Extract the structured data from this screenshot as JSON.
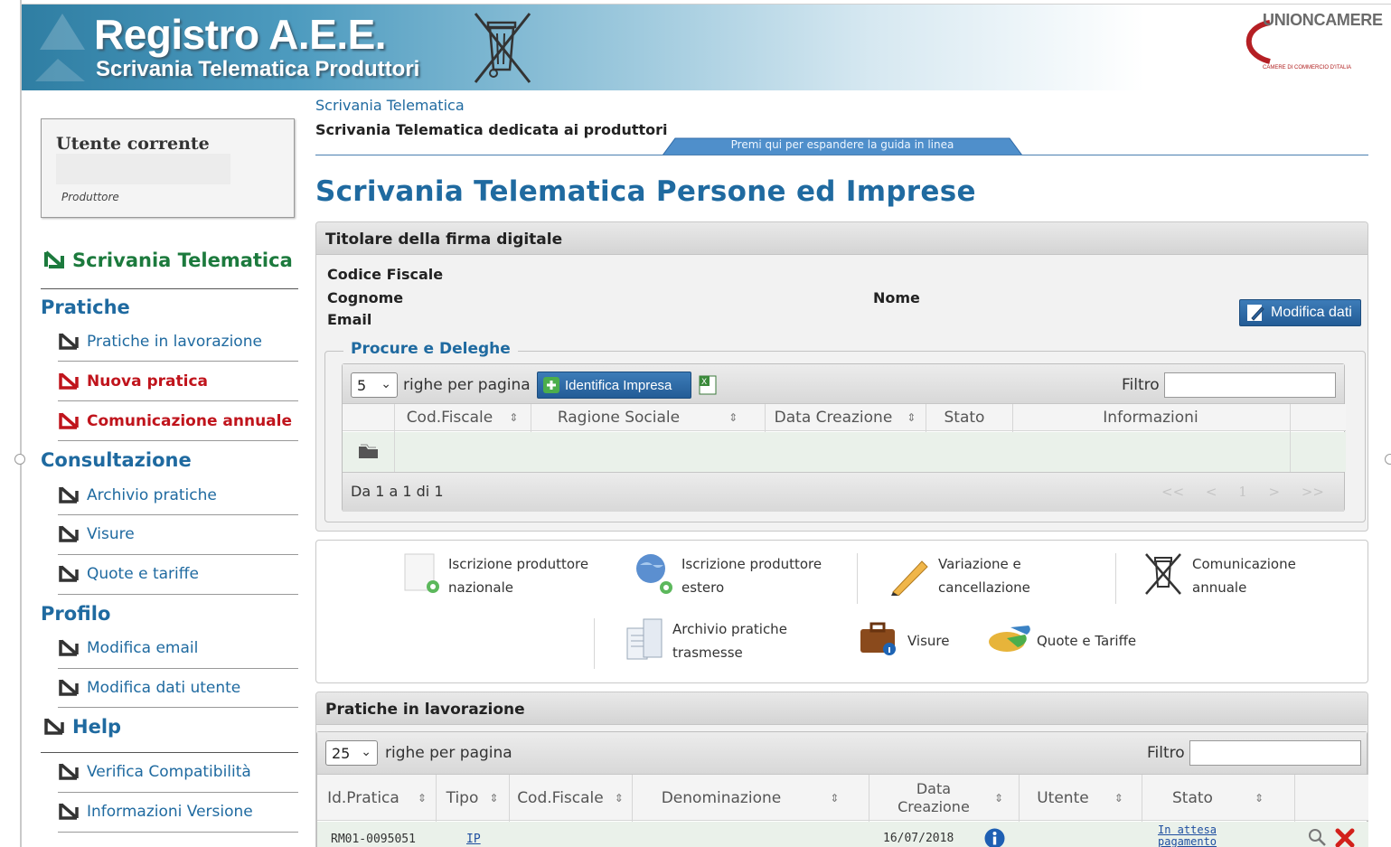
{
  "header": {
    "title": "Registro A.E.E.",
    "subtitle": "Scrivania Telematica Produttori",
    "brand": "UNIONCAMERE",
    "brand_sub": "CAMERE DI COMMERCIO D'ITALIA",
    "colors": {
      "accent": "#1f6aa0",
      "green": "#1c7a3d",
      "red": "#c0141c"
    }
  },
  "user": {
    "title": "Utente corrente",
    "role": "Produttore"
  },
  "sidebar": {
    "main": "Scrivania Telematica",
    "sections": [
      {
        "label": "Pratiche",
        "items": [
          "Pratiche in lavorazione",
          "Nuova pratica",
          "Comunicazione annuale"
        ]
      },
      {
        "label": "Consultazione",
        "items": [
          "Archivio pratiche",
          "Visure",
          "Quote e tariffe"
        ]
      },
      {
        "label": "Profilo",
        "items": [
          "Modifica email",
          "Modifica dati utente"
        ]
      }
    ],
    "help": {
      "label": "Help",
      "items": [
        "Verifica Compatibilità",
        "Informazioni Versione"
      ]
    }
  },
  "main": {
    "breadcrumb": "Scrivania Telematica",
    "subtitle": "Scrivania Telematica dedicata ai produttori",
    "guide_tab": "Premi qui per espandere la guida in linea",
    "page_title": "Scrivania Telematica Persone ed Imprese"
  },
  "titolare": {
    "header": "Titolare della firma digitale",
    "codice_fiscale_label": "Codice Fiscale",
    "cognome_label": "Cognome",
    "nome_label": "Nome",
    "email_label": "Email",
    "edit_button": "Modifica dati",
    "procure": {
      "legend": "Procure e Deleghe",
      "page_size": "5",
      "rows_per_page": "righe per pagina",
      "identify_button": "Identifica Impresa",
      "filter_label": "Filtro",
      "columns": [
        "Cod.Fiscale",
        "Ragione Sociale",
        "Data Creazione",
        "Stato",
        "Informazioni"
      ],
      "footer": "Da 1 a 1 di 1",
      "pager": {
        "first": "<<",
        "prev": "<",
        "page": "1",
        "next": ">",
        "last": ">>"
      }
    }
  },
  "shortcuts": [
    {
      "line1": "Iscrizione produttore",
      "line2": "nazionale",
      "icon": "document-add-icon"
    },
    {
      "line1": "Iscrizione produttore",
      "line2": "estero",
      "icon": "globe-add-icon"
    },
    {
      "line1": "Variazione e",
      "line2": "cancellazione",
      "icon": "pencil-icon"
    },
    {
      "line1": "Comunicazione",
      "line2": "annuale",
      "icon": "crossed-bin-icon"
    },
    {
      "line1": "Archivio pratiche",
      "line2": "trasmesse",
      "icon": "archive-icon"
    },
    {
      "line1": "Visure",
      "line2": "",
      "icon": "briefcase-info-icon"
    },
    {
      "line1": "Quote e Tariffe",
      "line2": "",
      "icon": "pie-chart-icon"
    }
  ],
  "pratiche": {
    "header": "Pratiche in lavorazione",
    "page_size": "25",
    "rows_per_page": "righe per pagina",
    "filter_label": "Filtro",
    "columns": [
      "Id.Pratica",
      "Tipo",
      "Cod.Fiscale",
      "Denominazione",
      "Data Creazione",
      "Utente",
      "Stato"
    ],
    "rows": [
      {
        "id": "RM01-0095051",
        "tipo": "IP",
        "cod_fiscale": "",
        "denominazione": "",
        "data": "16/07/2018",
        "utente": "",
        "stato": "In attesa pagamento"
      }
    ]
  }
}
